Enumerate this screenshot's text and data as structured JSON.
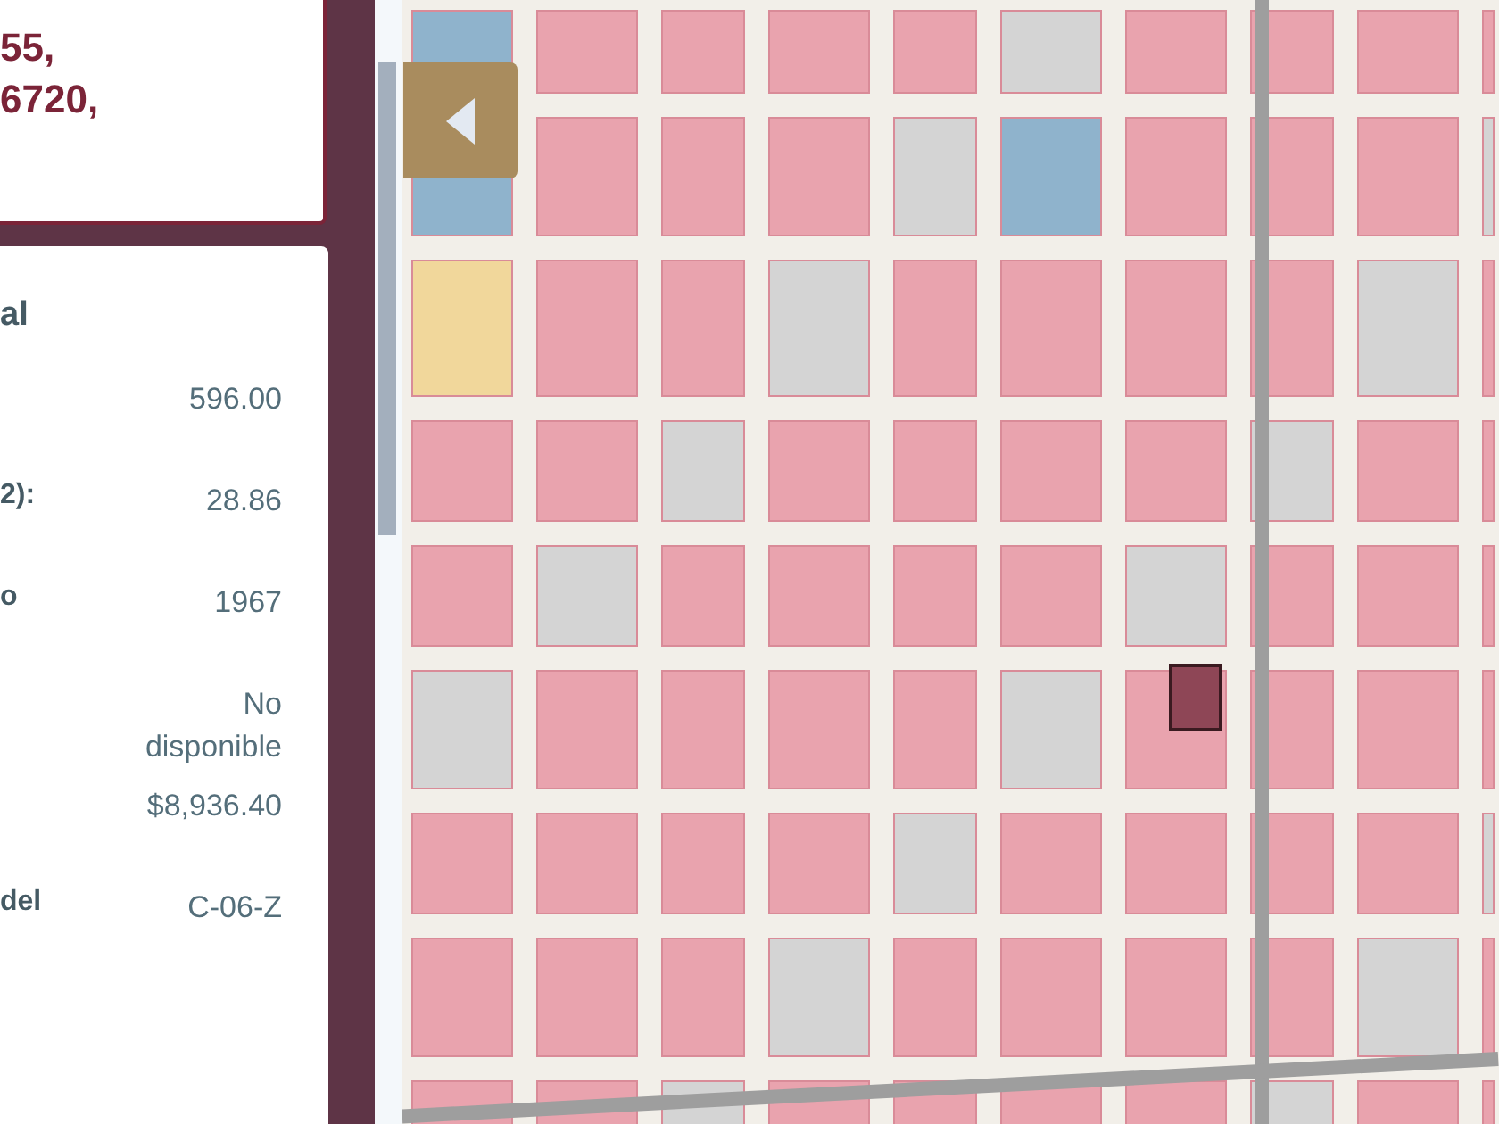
{
  "header_card": {
    "lines": [
      "55,",
      "6720,"
    ]
  },
  "details_card": {
    "title": "al",
    "rows": [
      {
        "value": "596.00"
      },
      {
        "label": "2):",
        "value": "28.86"
      },
      {
        "label": "o",
        "value": "1967"
      },
      {
        "value": "No disponible"
      },
      {
        "value": "$8,936.40"
      },
      {
        "label": "del",
        "value": "C-06-Z"
      }
    ]
  }
}
